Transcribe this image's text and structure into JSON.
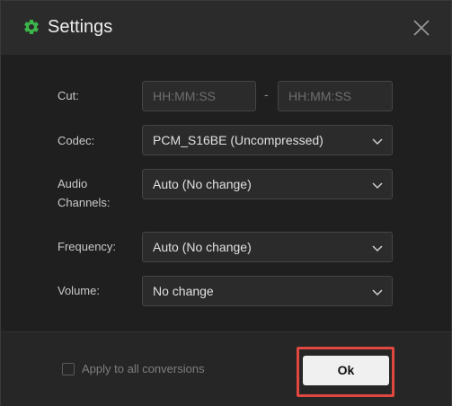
{
  "window": {
    "title": "Settings",
    "title_icon": "gear-icon",
    "close_icon": "close-icon",
    "accent_color": "#3cb54a"
  },
  "form": {
    "cut": {
      "label": "Cut:",
      "start_placeholder": "HH:MM:SS",
      "start_value": "",
      "separator": "-",
      "end_placeholder": "HH:MM:SS",
      "end_value": ""
    },
    "codec": {
      "label": "Codec:",
      "value": "PCM_S16BE (Uncompressed)"
    },
    "audio_channels": {
      "label_line1": "Audio",
      "label_line2": "Channels:",
      "value": "Auto (No change)"
    },
    "frequency": {
      "label": "Frequency:",
      "value": "Auto (No change)"
    },
    "volume": {
      "label": "Volume:",
      "value": "No change"
    }
  },
  "footer": {
    "apply_all_label": "Apply to all conversions",
    "apply_all_checked": false,
    "ok_label": "Ok",
    "highlight_color": "#e0483f"
  }
}
